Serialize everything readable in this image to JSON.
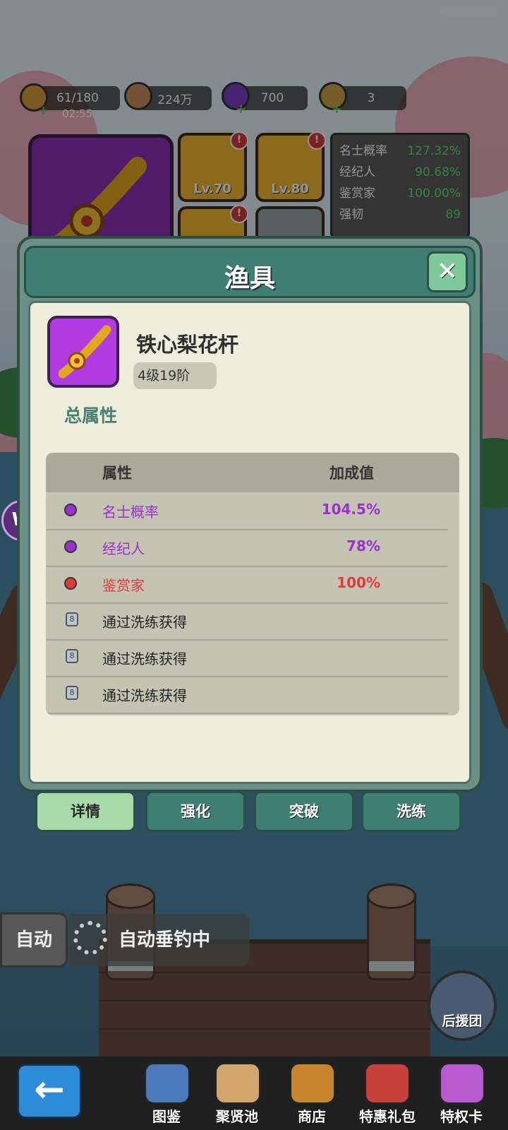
{
  "watermark": "40012551",
  "resources": {
    "stamina": {
      "value": "61/180",
      "timer": "02:55",
      "icon": "fish-bread-icon"
    },
    "coins": {
      "value": "224万",
      "icon": "coin-icon"
    },
    "gems": {
      "value": "700",
      "icon": "purple-gem-icon"
    },
    "tickets": {
      "value": "3",
      "icon": "ticket-icon"
    }
  },
  "gear_panel": {
    "slots": [
      {
        "level": "Lv.70",
        "icon": "red-net-icon",
        "alert": "!"
      },
      {
        "level": "Lv.80",
        "icon": "lantern-lure-icon",
        "alert": "!"
      },
      {
        "level": "",
        "icon": "reel-icon",
        "alert": "!"
      },
      {
        "level": "",
        "icon": "locked-slot-icon",
        "alert": ""
      }
    ],
    "stats": [
      {
        "name": "名士概率",
        "value": "127.32%"
      },
      {
        "name": "经纪人",
        "value": "90.68%"
      },
      {
        "name": "鉴赏家",
        "value": "100.00%"
      },
      {
        "name": "强韧",
        "value": "89"
      }
    ]
  },
  "modal": {
    "title": "渔具",
    "close_icon": "close-icon",
    "item": {
      "name": "铁心梨花杆",
      "grade": "4级19阶",
      "icon": "golden-fishing-rod-icon"
    },
    "section_title": "总属性",
    "table": {
      "headers": {
        "attribute": "属性",
        "bonus": "加成值"
      },
      "rows": [
        {
          "name": "名士概率",
          "value": "104.5%",
          "color": "#9b2fd0",
          "locked": false
        },
        {
          "name": "经纪人",
          "value": "78%",
          "color": "#9b2fd0",
          "locked": false
        },
        {
          "name": "鉴赏家",
          "value": "100%",
          "color": "#e03a3a",
          "locked": false
        },
        {
          "name": "通过洗练获得",
          "value": "",
          "color": "#222222",
          "locked": true
        },
        {
          "name": "通过洗练获得",
          "value": "",
          "color": "#222222",
          "locked": true
        },
        {
          "name": "通过洗练获得",
          "value": "",
          "color": "#222222",
          "locked": true
        }
      ]
    }
  },
  "tabs": [
    {
      "label": "详情",
      "active": true
    },
    {
      "label": "强化",
      "active": false
    },
    {
      "label": "突破",
      "active": false
    },
    {
      "label": "洗练",
      "active": false
    }
  ],
  "auto": {
    "button_label": "自动",
    "status_label": "自动垂钓中"
  },
  "support_label": "后援团",
  "nav": {
    "back_icon": "back-arrow-icon",
    "items": [
      {
        "label": "图鉴",
        "icon": "book-icon"
      },
      {
        "label": "聚贤池",
        "icon": "map-scroll-icon"
      },
      {
        "label": "商店",
        "icon": "treasure-basket-icon"
      },
      {
        "label": "特惠礼包",
        "icon": "gift-pack-icon"
      },
      {
        "label": "特权卡",
        "icon": "privilege-card-icon"
      }
    ]
  },
  "colors": {
    "modal_header": "#3f7f73",
    "tab_active": "#a8dba9",
    "attr_purple": "#9b2fd0",
    "attr_red": "#e03a3a"
  }
}
